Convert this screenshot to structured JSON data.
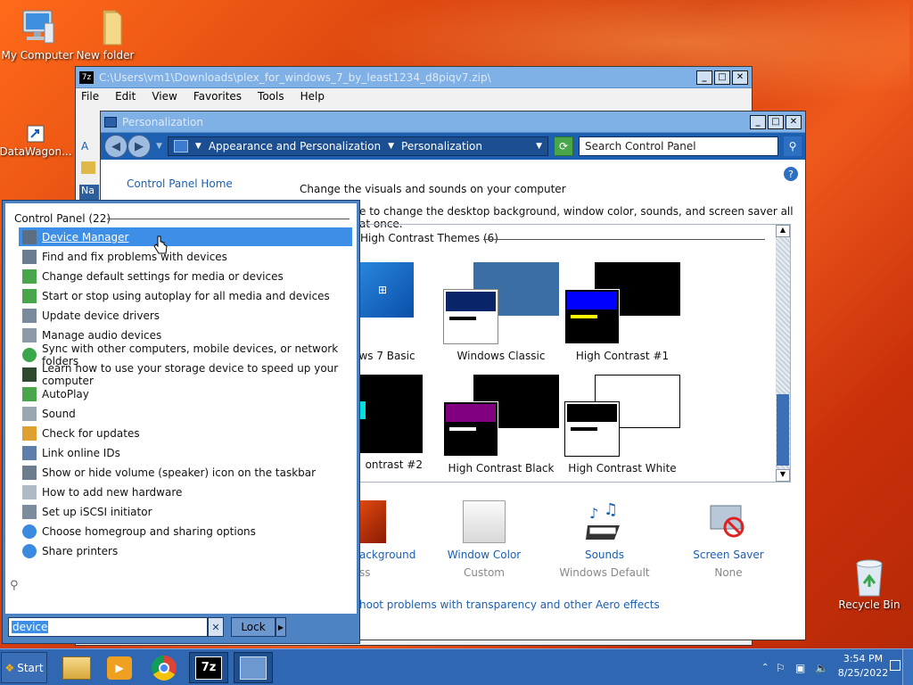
{
  "desktop": {
    "icons": [
      {
        "label": "My Computer",
        "icon": "computer-icon"
      },
      {
        "label": "New folder",
        "icon": "folder-icon"
      },
      {
        "label": "DataWagon...",
        "icon": "shortcut-icon"
      },
      {
        "label": "Recycle Bin",
        "icon": "recycle-bin-icon"
      }
    ]
  },
  "sevenzip_window": {
    "title": "C:\\Users\\vm1\\Downloads\\plex_for_windows_7_by_least1234_d8piqv7.zip\\",
    "menu": [
      "File",
      "Edit",
      "View",
      "Favorites",
      "Tools",
      "Help"
    ],
    "left_stub_label": "A",
    "left_stub_label2": "Na"
  },
  "personalization_window": {
    "title": "Personalization",
    "breadcrumb": [
      "Appearance and Personalization",
      "Personalization"
    ],
    "search_placeholder": "Search Control Panel",
    "home_link": "Control Panel Home",
    "heading": "Change the visuals and sounds on your computer",
    "subheading": "e to change the desktop background, window color, sounds, and screen saver all at once.",
    "group_header": "High Contrast Themes (6)",
    "themes_row1": [
      "ws 7 Basic",
      "Windows Classic",
      "High Contrast #1"
    ],
    "themes_row2": [
      "ontrast #2",
      "High Contrast Black",
      "High Contrast White"
    ],
    "bottom_items": [
      {
        "label": "ackground",
        "sub": "ss"
      },
      {
        "label": "Window Color",
        "sub": "Custom"
      },
      {
        "label": "Sounds",
        "sub": "Windows Default"
      },
      {
        "label": "Screen Saver",
        "sub": "None"
      }
    ],
    "troubleshoot_link": "hoot problems with transparency and other Aero effects"
  },
  "start_menu": {
    "group_header": "Control Panel (22)",
    "items": [
      "Device Manager",
      "Find and fix problems with devices",
      "Change default settings for media or devices",
      "Start or stop using autoplay for all media and devices",
      "Update device drivers",
      "Manage audio devices",
      "Sync with other computers, mobile devices, or network folders",
      "Learn how to use your storage device to speed up your computer",
      "AutoPlay",
      "Sound",
      "Check for updates",
      "Link online IDs",
      "Show or hide volume (speaker) icon on the taskbar",
      "How to add new hardware",
      "Set up iSCSI initiator",
      "Choose homegroup and sharing options",
      "Share printers"
    ],
    "search_value": "device",
    "lock_label": "Lock"
  },
  "taskbar": {
    "start_label": "Start",
    "time": "3:54 PM",
    "date": "8/25/2022"
  }
}
